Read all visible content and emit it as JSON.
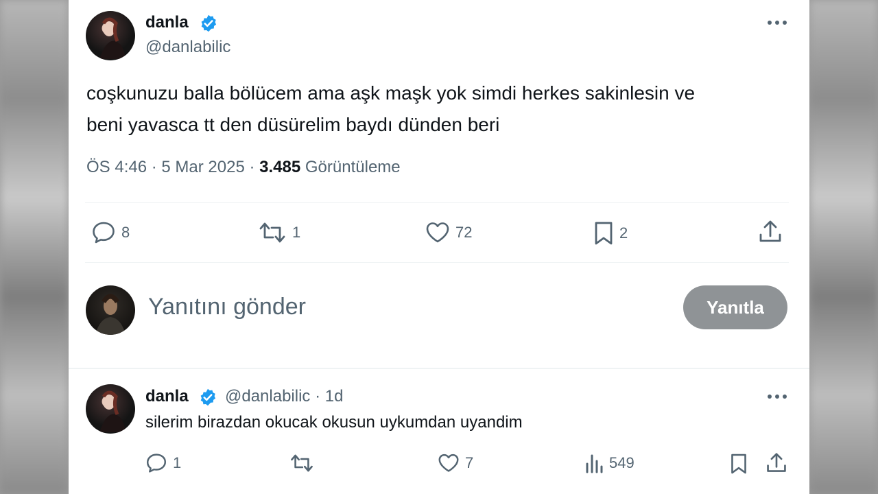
{
  "tweet": {
    "author_name": "danla",
    "author_handle": "@danlabilic",
    "text_line1": "coşkunuzu balla bölücem ama aşk maşk yok simdi herkes sakinlesin ve",
    "text_line2": "beni yavasca tt den düsürelim baydı dünden beri",
    "time": "ÖS 4:46",
    "date": "5 Mar 2025",
    "views": "3.485",
    "views_label": "Görüntüleme",
    "separator": "·",
    "actions": {
      "replies": "8",
      "reposts": "1",
      "likes": "72",
      "bookmarks": "2"
    }
  },
  "composer": {
    "placeholder": "Yanıtını gönder",
    "button_label": "Yanıtla"
  },
  "reply": {
    "author_name": "danla",
    "author_handle": "@danlabilic",
    "age": "· 1d",
    "text": "silerim birazdan okucak okusun uykumdan uyandim",
    "actions": {
      "replies": "1",
      "likes": "7",
      "views": "549"
    }
  },
  "colors": {
    "verified": "#1d9bf0",
    "text_primary": "#0f1419",
    "text_secondary": "#536471",
    "button_disabled": "#8f9396"
  },
  "icons": [
    "verified-badge-icon",
    "more-icon",
    "reply-icon",
    "repost-icon",
    "like-icon",
    "bookmark-icon",
    "share-icon",
    "views-icon"
  ]
}
